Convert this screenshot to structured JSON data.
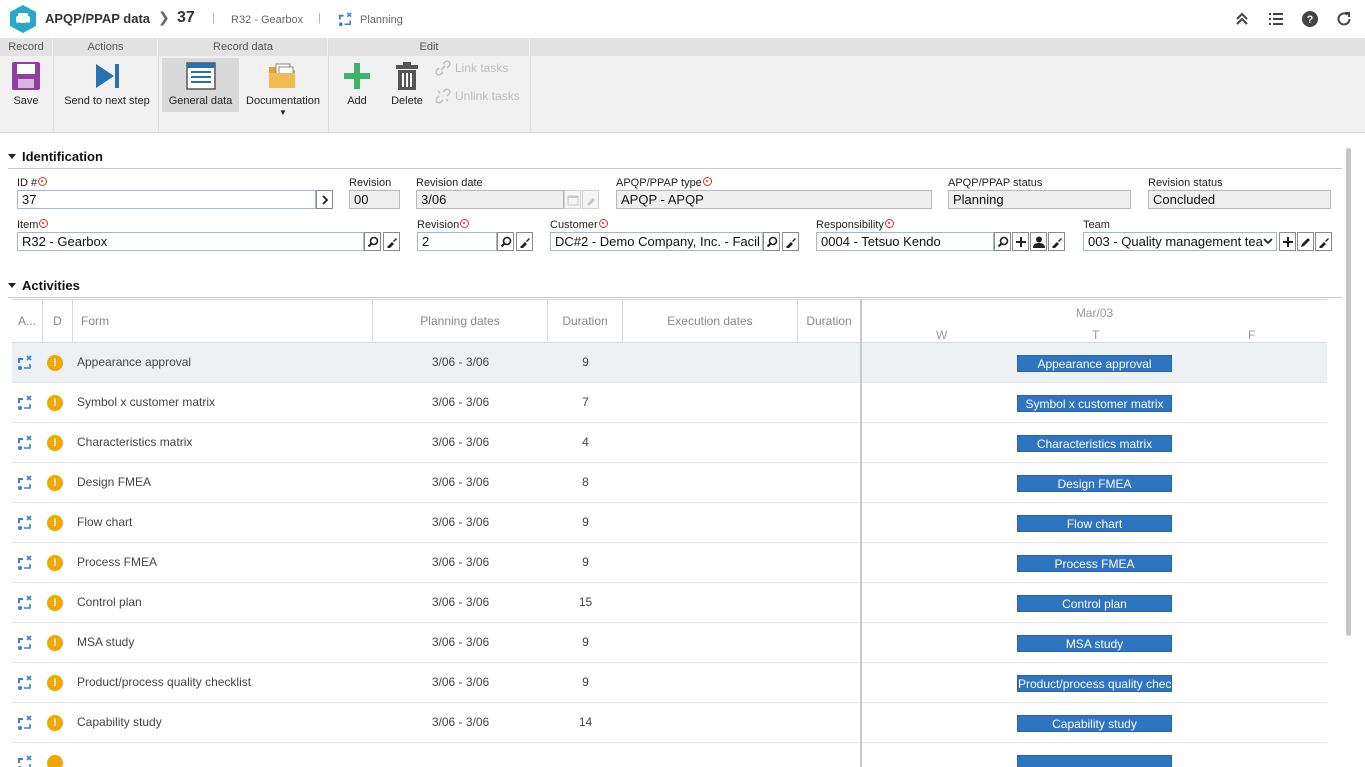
{
  "header": {
    "app_title": "APQP/PPAP data",
    "record_id": "37",
    "breadcrumb_item": "R32 - Gearbox",
    "breadcrumb_step": "Planning"
  },
  "ribbon": {
    "groups": {
      "record": "Record",
      "actions": "Actions",
      "record_data": "Record data",
      "edit": "Edit"
    },
    "save": "Save",
    "send_next": "Send to next step",
    "general_data": "General data",
    "documentation": "Documentation",
    "add": "Add",
    "delete": "Delete",
    "link_tasks": "Link tasks",
    "unlink_tasks": "Unlink tasks"
  },
  "identification": {
    "title": "Identification",
    "id_label": "ID #",
    "id_value": "37",
    "revision_label": "Revision",
    "revision_value": "00",
    "revision_date_label": "Revision date",
    "revision_date_value": "3/06",
    "type_label": "APQP/PPAP type",
    "type_value": "APQP - APQP",
    "status_label": "APQP/PPAP status",
    "status_value": "Planning",
    "rev_status_label": "Revision status",
    "rev_status_value": "Concluded",
    "item_label": "Item",
    "item_value": "R32 - Gearbox",
    "item_rev_label": "Revision",
    "item_rev_value": "2",
    "customer_label": "Customer",
    "customer_value": "DC#2 - Demo Company, Inc. - Facil",
    "responsibility_label": "Responsibility",
    "responsibility_value": "0004 - Tetsuo Kendo",
    "team_label": "Team",
    "team_value": "003 - Quality management tea"
  },
  "activities": {
    "title": "Activities",
    "columns": {
      "a": "A...",
      "d": "D",
      "form": "Form",
      "planning": "Planning dates",
      "duration": "Duration",
      "execution": "Execution dates",
      "duration2": "Duration"
    },
    "gantt": {
      "month": "Mar/03",
      "days": [
        "W",
        "T",
        "F"
      ]
    },
    "rows": [
      {
        "form": "Appearance approval",
        "planning": "3/06 - 3/06",
        "duration": "9",
        "bar": "Appearance approval"
      },
      {
        "form": "Symbol x customer matrix",
        "planning": "3/06 - 3/06",
        "duration": "7",
        "bar": "Symbol x customer matrix"
      },
      {
        "form": "Characteristics matrix",
        "planning": "3/06 - 3/06",
        "duration": "4",
        "bar": "Characteristics matrix"
      },
      {
        "form": "Design FMEA",
        "planning": "3/06 - 3/06",
        "duration": "8",
        "bar": "Design FMEA"
      },
      {
        "form": "Flow chart",
        "planning": "3/06 - 3/06",
        "duration": "9",
        "bar": "Flow chart"
      },
      {
        "form": "Process FMEA",
        "planning": "3/06 - 3/06",
        "duration": "9",
        "bar": "Process FMEA"
      },
      {
        "form": "Control plan",
        "planning": "3/06 - 3/06",
        "duration": "15",
        "bar": "Control plan"
      },
      {
        "form": "MSA study",
        "planning": "3/06 - 3/06",
        "duration": "9",
        "bar": "MSA study"
      },
      {
        "form": "Product/process quality checklist",
        "planning": "3/06 - 3/06",
        "duration": "9",
        "bar": "Product/process quality chec"
      },
      {
        "form": "Capability study",
        "planning": "3/06 - 3/06",
        "duration": "14",
        "bar": "Capability study"
      }
    ]
  }
}
